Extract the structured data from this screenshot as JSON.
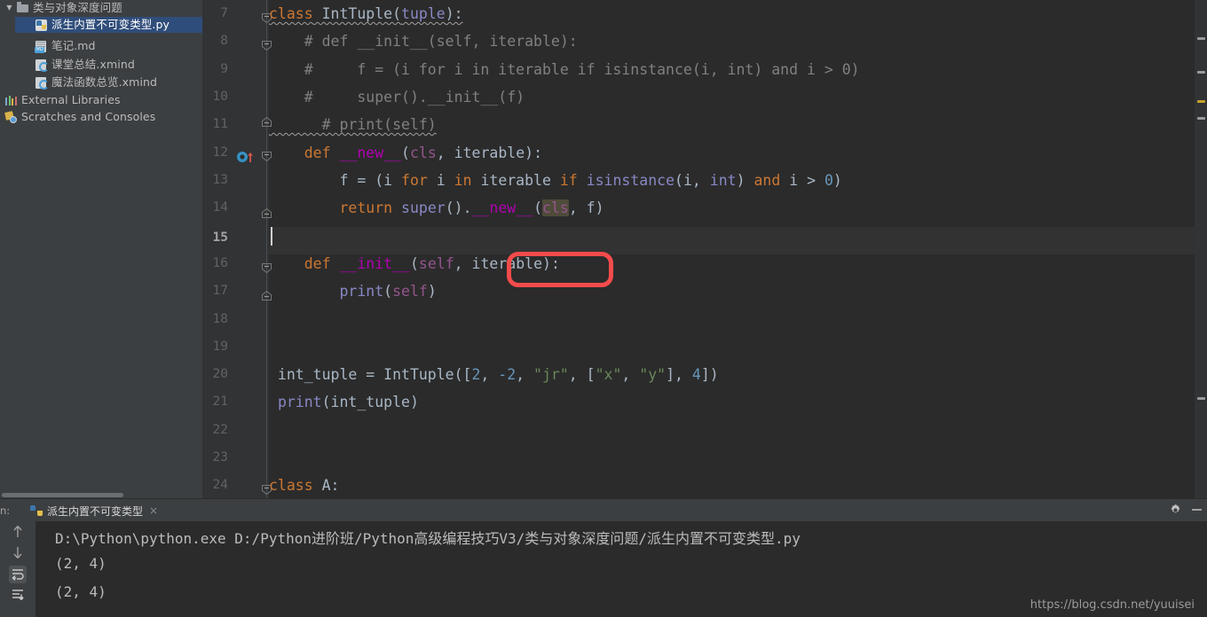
{
  "sidebar": {
    "items": [
      {
        "label": "类与对象深度问题",
        "icon": "folder-icon",
        "indent": 1,
        "twisty": "▼",
        "selected": false
      },
      {
        "label": "派生内置不可变类型.py",
        "icon": "python-file-icon",
        "indent": 2,
        "twisty": "",
        "selected": true
      },
      {
        "label": "笔记.md",
        "icon": "markdown-file-icon",
        "indent": 2,
        "twisty": "",
        "selected": false
      },
      {
        "label": "课堂总结.xmind",
        "icon": "xmind-file-icon",
        "indent": 2,
        "twisty": "",
        "selected": false
      },
      {
        "label": "魔法函数总览.xmind",
        "icon": "xmind-file-icon",
        "indent": 2,
        "twisty": "",
        "selected": false
      },
      {
        "label": "External Libraries",
        "icon": "libraries-icon",
        "indent": 1,
        "twisty": "",
        "selected": false
      },
      {
        "label": "Scratches and Consoles",
        "icon": "scratches-icon",
        "indent": 1,
        "twisty": "",
        "selected": false
      }
    ]
  },
  "editor": {
    "first_line": 7,
    "current_line": 15,
    "line_numbers": [
      7,
      8,
      9,
      10,
      11,
      12,
      13,
      14,
      15,
      16,
      17,
      18,
      19,
      20,
      21,
      22,
      23,
      24
    ],
    "lines": [
      {
        "n": 7,
        "text": "class IntTuple(tuple):"
      },
      {
        "n": 8,
        "text": "    # def __init__(self, iterable):"
      },
      {
        "n": 9,
        "text": "    #     f = (i for i in iterable if isinstance(i, int) and i > 0)"
      },
      {
        "n": 10,
        "text": "    #     super().__init__(f)"
      },
      {
        "n": 11,
        "text": "      # print(self)"
      },
      {
        "n": 12,
        "text": "    def __new__(cls, iterable):"
      },
      {
        "n": 13,
        "text": "        f = (i for i in iterable if isinstance(i, int) and i > 0)"
      },
      {
        "n": 14,
        "text": "        return super().__new__(cls, f)"
      },
      {
        "n": 15,
        "text": ""
      },
      {
        "n": 16,
        "text": "    def __init__(self, iterable):"
      },
      {
        "n": 17,
        "text": "        print(self)"
      },
      {
        "n": 18,
        "text": ""
      },
      {
        "n": 19,
        "text": ""
      },
      {
        "n": 20,
        "text": "int_tuple = IntTuple([2, -2, \"jr\", [\"x\", \"y\"], 4])"
      },
      {
        "n": 21,
        "text": "print(int_tuple)"
      },
      {
        "n": 22,
        "text": ""
      },
      {
        "n": 23,
        "text": ""
      },
      {
        "n": 24,
        "text": "class A:"
      }
    ],
    "highlighted_token": "cls",
    "annotation_token": "iterable",
    "gutter_icon_line": 12,
    "gutter_icon_name": "overriding-method-icon"
  },
  "run_panel": {
    "label": "n:",
    "tab_label": "派生内置不可变类型",
    "tab_close": "×",
    "console_lines": [
      "D:\\Python\\python.exe D:/Python进阶班/Python高级编程技巧V3/类与对象深度问题/派生内置不可变类型.py",
      "(2, 4)",
      "(2, 4)"
    ],
    "tools": [
      "up-arrow-icon",
      "down-arrow-icon",
      "soft-wrap-icon",
      "scroll-to-end-icon"
    ]
  },
  "watermark": "https://blog.csdn.net/yuuisei",
  "colors": {
    "background": "#2b2b2b",
    "panel": "#3c3f41",
    "gutter": "#313335",
    "selection": "#2f4d7a",
    "keyword": "#cc7832",
    "string": "#6a8759",
    "number": "#6897bb",
    "comment": "#808080",
    "function": "#ffc66d",
    "self": "#94558d",
    "magic": "#b200b2",
    "builtin": "#8888c6",
    "text": "#a9b7c6",
    "annotation": "#f54b4b",
    "token_highlight": "#4f4b3a"
  }
}
